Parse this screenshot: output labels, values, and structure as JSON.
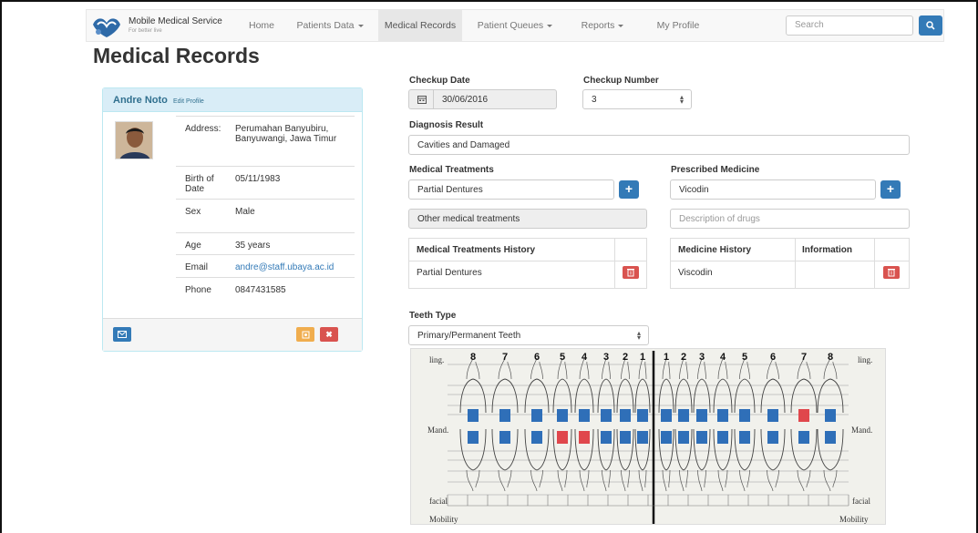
{
  "navbar": {
    "brand_name": "Mobile Medical Service",
    "brand_tagline": "For better live",
    "items": [
      {
        "label": "Home",
        "dropdown": false,
        "active": false
      },
      {
        "label": "Patients Data",
        "dropdown": true,
        "active": false
      },
      {
        "label": "Medical Records",
        "dropdown": false,
        "active": true
      },
      {
        "label": "Patient Queues",
        "dropdown": true,
        "active": false
      },
      {
        "label": "Reports",
        "dropdown": true,
        "active": false
      },
      {
        "label": "My Profile",
        "dropdown": false,
        "active": false
      }
    ],
    "search_placeholder": "Search"
  },
  "page_title": "Medical Records",
  "patient": {
    "name": "Andre Noto",
    "edit_label": "Edit Profile",
    "rows": [
      {
        "label": "Address:",
        "value": "Perumahan Banyubiru, Banyuwangi, Jawa Timur"
      },
      {
        "label": "Birth of Date",
        "value": "05/11/1983"
      },
      {
        "label": "Sex",
        "value": "Male"
      },
      {
        "label": "Age",
        "value": "35 years"
      },
      {
        "label": "Email",
        "value": "andre@staff.ubaya.ac.id"
      },
      {
        "label": "Phone",
        "value": "0847431585"
      }
    ]
  },
  "form": {
    "checkup_date_label": "Checkup Date",
    "checkup_date_value": "30/06/2016",
    "checkup_number_label": "Checkup Number",
    "checkup_number_value": "3",
    "diagnosis_label": "Diagnosis Result",
    "diagnosis_value": "Cavities and Damaged",
    "treatments_label": "Medical Treatments",
    "treatment_value": "Partial Dentures",
    "other_treatments": "Other medical treatments",
    "medicine_label": "Prescribed Medicine",
    "medicine_value": "Vicodin",
    "drug_placeholder": "Description of drugs",
    "treatment_history": {
      "header": "Medical Treatments History",
      "rows": [
        "Partial Dentures"
      ]
    },
    "medicine_history": {
      "headers": [
        "Medicine History",
        "Information"
      ],
      "rows": [
        {
          "medicine": "Viscodin",
          "info": ""
        }
      ]
    },
    "teeth_type_label": "Teeth Type",
    "teeth_type_value": "Primary/Permanent Teeth"
  },
  "teeth_chart": {
    "ling_label": "ling.",
    "mand_label": "Mand.",
    "facial_label": "facial",
    "mobility_label": "Mobility",
    "right_numbers": [
      "8",
      "7",
      "6",
      "5",
      "4",
      "3",
      "2",
      "1"
    ],
    "left_numbers": [
      "1",
      "2",
      "3",
      "4",
      "5",
      "6",
      "7",
      "8"
    ],
    "colors": {
      "ok": "#2f6fb8",
      "problem": "#e0474c"
    },
    "upper_markers": [
      "ok",
      "ok",
      "ok",
      "ok",
      "ok",
      "ok",
      "ok",
      "ok",
      "ok",
      "ok",
      "ok",
      "ok",
      "ok",
      "ok",
      "problem",
      "ok"
    ],
    "lower_markers": [
      "ok",
      "ok",
      "ok",
      "problem",
      "problem",
      "ok",
      "ok",
      "ok",
      "ok",
      "ok",
      "ok",
      "ok",
      "ok",
      "ok",
      "ok",
      "ok"
    ]
  }
}
